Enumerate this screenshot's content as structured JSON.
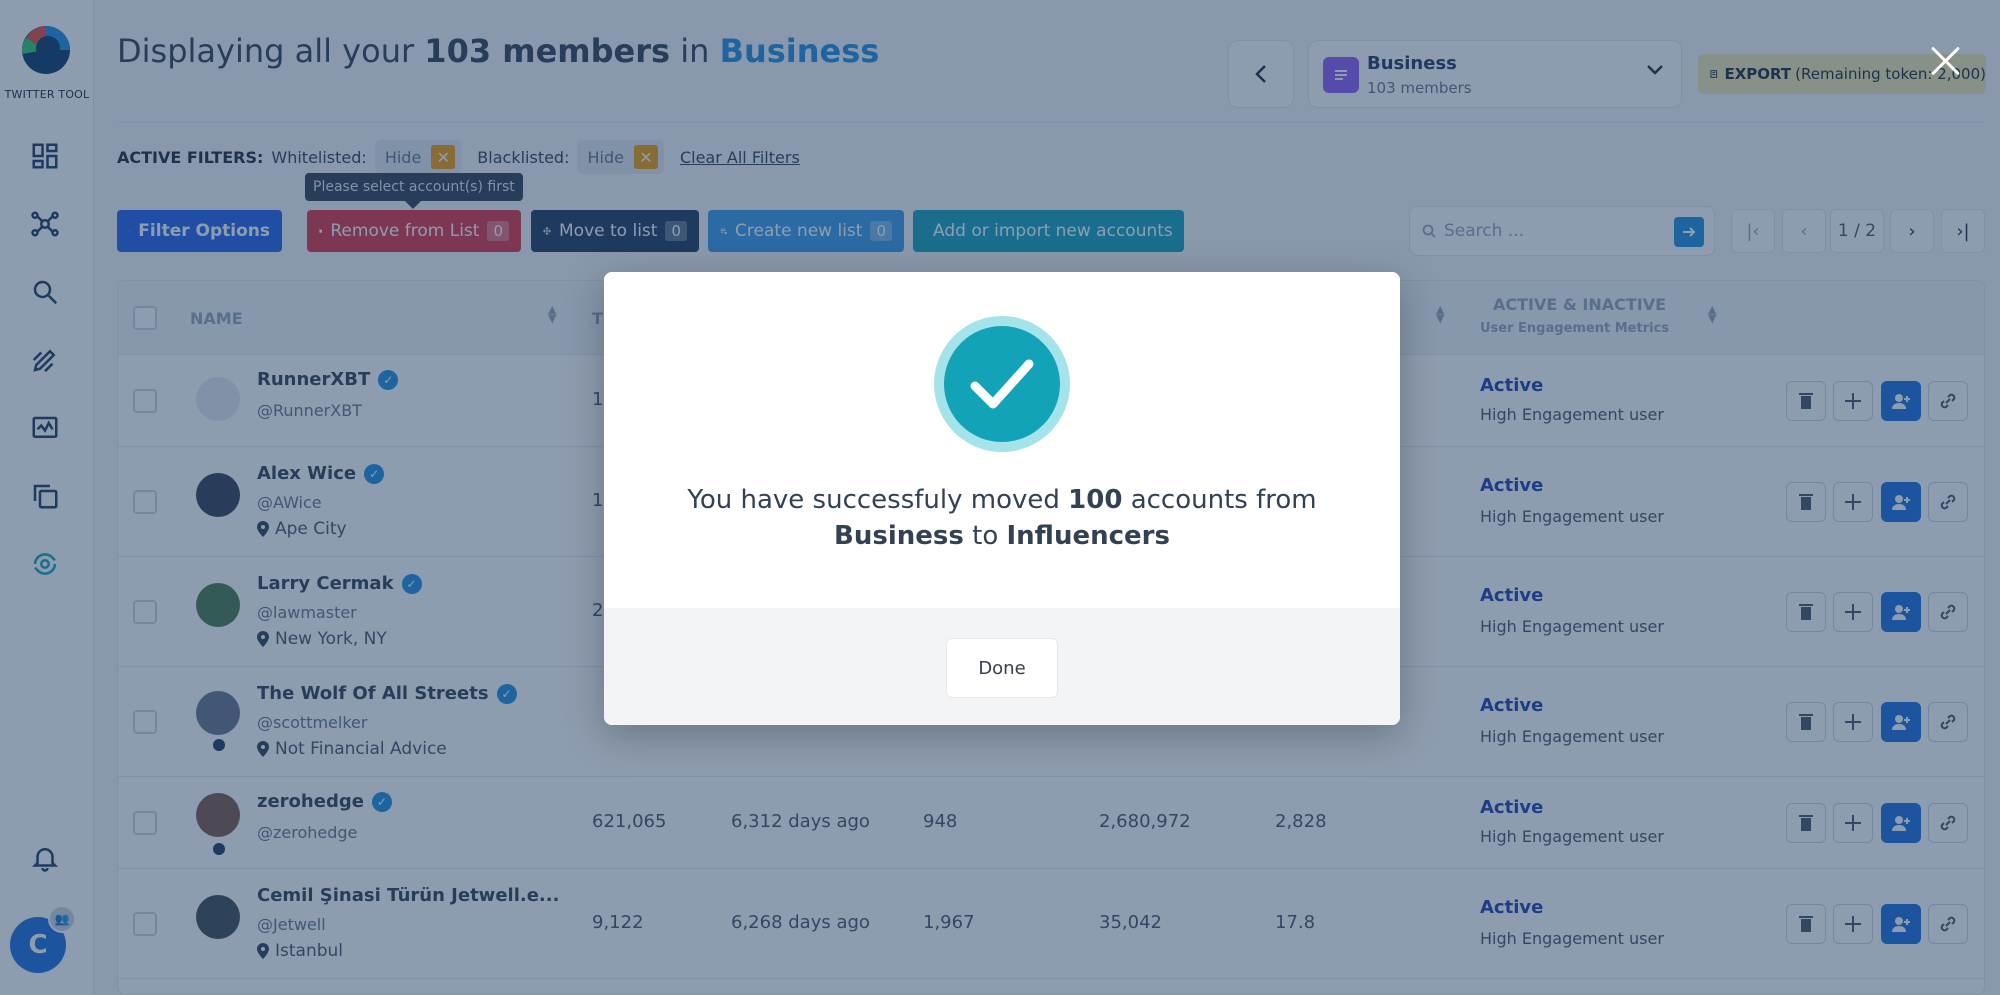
{
  "app": {
    "logo_text": "TWITTER TOOL"
  },
  "sidebar": {
    "items": [
      {
        "name": "dashboard-icon"
      },
      {
        "name": "network-icon"
      },
      {
        "name": "search-icon"
      },
      {
        "name": "edit-icon"
      },
      {
        "name": "monitor-icon"
      },
      {
        "name": "copy-icon"
      },
      {
        "name": "sync-icon"
      }
    ],
    "avatar_letter": "C"
  },
  "header": {
    "title_prefix": "Displaying all your",
    "title_count": "103 members",
    "title_in": "in",
    "title_list": "Business",
    "list_select": {
      "name": "Business",
      "count": "103 members"
    },
    "export_label": "EXPORT",
    "export_note": "(Remaining token: 2,000)"
  },
  "filters": {
    "label": "ACTIVE FILTERS:",
    "whitelisted_label": "Whitelisted:",
    "whitelisted_value": "Hide",
    "blacklisted_label": "Blacklisted:",
    "blacklisted_value": "Hide",
    "clear_label": "Clear All Filters"
  },
  "tooltip": "Please select account(s) first",
  "toolbar": {
    "filter_options": "Filter Options",
    "remove_from_list": "Remove from List",
    "remove_count": "0",
    "move_to_list": "Move to list",
    "move_count": "0",
    "create_new_list": "Create new list",
    "create_count": "0",
    "add_import": "Add or import new accounts",
    "search_placeholder": "Search ...",
    "page": "1 / 2"
  },
  "table": {
    "columns": {
      "name": "NAME",
      "t": "T",
      "status": "ACTIVE & INACTIVE",
      "status_sub": "User Engagement Metrics"
    },
    "rows": [
      {
        "name": "RunnerXBT",
        "handle": "@RunnerXBT",
        "location": "",
        "c1": "15",
        "c2": "",
        "c3": "",
        "c4": "",
        "c5": "",
        "status": "Active",
        "status_sub": "High Engagement user"
      },
      {
        "name": "Alex Wice",
        "handle": "@AWice",
        "location": "Ape City",
        "c1": "10",
        "c2": "",
        "c3": "",
        "c4": "",
        "c5": "",
        "status": "Active",
        "status_sub": "High Engagement user"
      },
      {
        "name": "Larry Cermak",
        "handle": "@lawmaster",
        "location": "New York, NY",
        "c1": "2",
        "c2": "",
        "c3": "",
        "c4": "",
        "c5": "",
        "status": "Active",
        "status_sub": "High Engagement user"
      },
      {
        "name": "The Wolf Of All Streets",
        "handle": "@scottmelker",
        "location": "Not Financial Advice",
        "c1": "",
        "c2": "",
        "c3": "",
        "c4": "",
        "c5": "",
        "status": "Active",
        "status_sub": "High Engagement user"
      },
      {
        "name": "zerohedge",
        "handle": "@zerohedge",
        "location": "",
        "c1": "621,065",
        "c2": "6,312 days ago",
        "c3": "948",
        "c4": "2,680,972",
        "c5": "2,828",
        "status": "Active",
        "status_sub": "High Engagement user"
      },
      {
        "name": "Cemil Şinasi Türün Jetwell.e...",
        "handle": "@Jetwell",
        "location": "Istanbul",
        "c1": "9,122",
        "c2": "6,268 days ago",
        "c3": "1,967",
        "c4": "35,042",
        "c5": "17.8",
        "status": "Active",
        "status_sub": "High Engagement user"
      }
    ]
  },
  "modal": {
    "msg_part1": "You have successfuly moved",
    "msg_count": "100",
    "msg_part2": "accounts from",
    "msg_from": "Business",
    "msg_to_word": "to",
    "msg_to": "Influencers",
    "done_label": "Done"
  },
  "colors": {
    "accent": "#1d8fe0",
    "success": "#13a3b8",
    "danger": "#dc3545",
    "primary": "#2563eb"
  }
}
